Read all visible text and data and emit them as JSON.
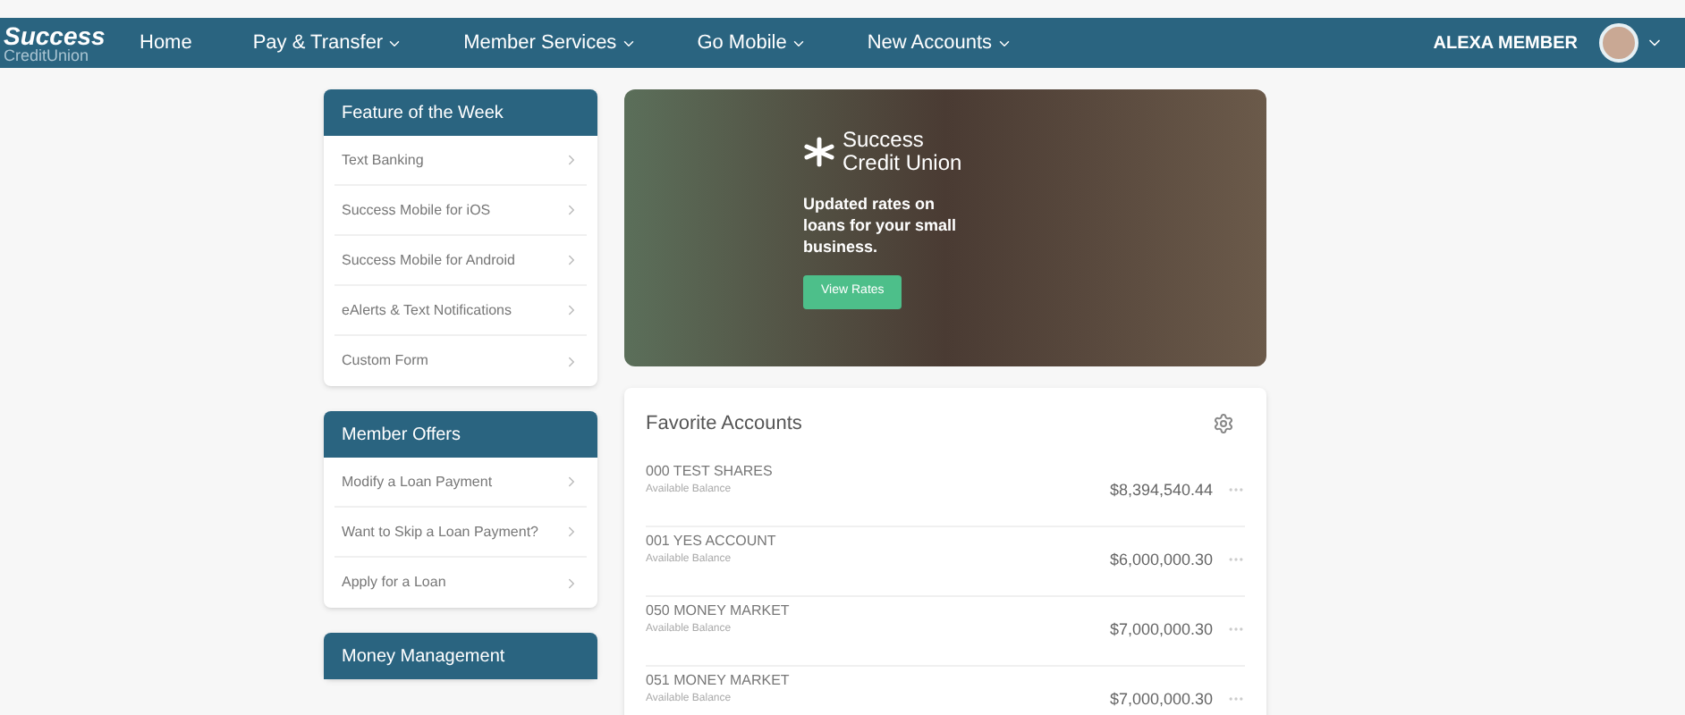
{
  "header": {
    "logo": {
      "line1": "Success",
      "line2": "CreditUnion"
    },
    "nav": [
      {
        "label": "Home",
        "dropdown": false
      },
      {
        "label": "Pay & Transfer",
        "dropdown": true
      },
      {
        "label": "Member Services",
        "dropdown": true
      },
      {
        "label": "Go Mobile",
        "dropdown": true
      },
      {
        "label": "New Accounts",
        "dropdown": true
      }
    ],
    "user": {
      "name": "ALEXA MEMBER",
      "dropdown": true
    }
  },
  "sidebar": [
    {
      "title": "Feature of the Week",
      "items": [
        "Text Banking",
        "Success Mobile for iOS",
        "Success Mobile for Android",
        "eAlerts & Text Notifications",
        "Custom Form"
      ]
    },
    {
      "title": "Member Offers",
      "items": [
        "Modify a Loan Payment",
        "Want to Skip a Loan Payment?",
        "Apply for a Loan"
      ]
    },
    {
      "title": "Money Management"
    }
  ],
  "hero": {
    "brand_line1": "Success",
    "brand_line2": "Credit Union",
    "message": "Updated rates on loans for your small business.",
    "button": "View Rates"
  },
  "favorite_accounts": {
    "title": "Favorite Accounts",
    "rows": [
      {
        "name": "000 TEST SHARES",
        "sublabel": "Available Balance",
        "balance": "$8,394,540.44"
      },
      {
        "name": "001 YES ACCOUNT",
        "sublabel": "Available Balance",
        "balance": "$6,000,000.30"
      },
      {
        "name": "050 MONEY MARKET",
        "sublabel": "Available Balance",
        "balance": "$7,000,000.30"
      },
      {
        "name": "051 MONEY MARKET",
        "sublabel": "Available Balance",
        "balance": "$7,000,000.30"
      }
    ]
  }
}
